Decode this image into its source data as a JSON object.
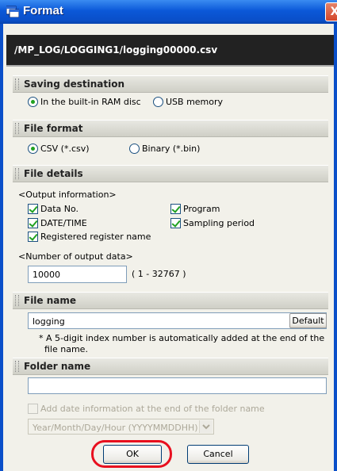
{
  "window": {
    "title": "Format",
    "close_glyph": "X",
    "icon": "app-window-icon"
  },
  "path": "/MP_LOG/LOGGING1/logging00000.csv",
  "saving_destination": {
    "heading": "Saving destination",
    "options": [
      "In the built-in RAM disc",
      "USB memory"
    ],
    "selected": "In the built-in RAM disc"
  },
  "file_format": {
    "heading": "File format",
    "options": [
      "CSV (*.csv)",
      "Binary (*.bin)"
    ],
    "selected": "CSV (*.csv)"
  },
  "file_details": {
    "heading": "File details",
    "output_info_label": "<Output information>",
    "items": {
      "data_no": {
        "label": "Data No.",
        "checked": true
      },
      "program": {
        "label": "Program",
        "checked": true
      },
      "date_time": {
        "label": "DATE/TIME",
        "checked": true
      },
      "sampling_period": {
        "label": "Sampling period",
        "checked": true
      },
      "registered_register_name": {
        "label": "Registered register name",
        "checked": true
      }
    },
    "num_output_label": "<Number of output data>",
    "num_output_value": "10000",
    "num_output_range": "( 1 - 32767 )"
  },
  "file_name": {
    "heading": "File name",
    "value": "logging",
    "default_button": "Default",
    "note_line1": "* A 5-digit index number is automatically added at the end of the",
    "note_line2": "file name."
  },
  "folder_name": {
    "heading": "Folder name",
    "value": "",
    "add_date_label": "Add date information at the end of the folder name",
    "add_date_checked": false,
    "date_format_value": "Year/Month/Day/Hour (YYYYMMDDHH)"
  },
  "buttons": {
    "ok": "OK",
    "cancel": "Cancel"
  },
  "colors": {
    "title_bar": "#0b58d8",
    "check_mark": "#21a121",
    "highlight_ring": "#e8101f"
  }
}
